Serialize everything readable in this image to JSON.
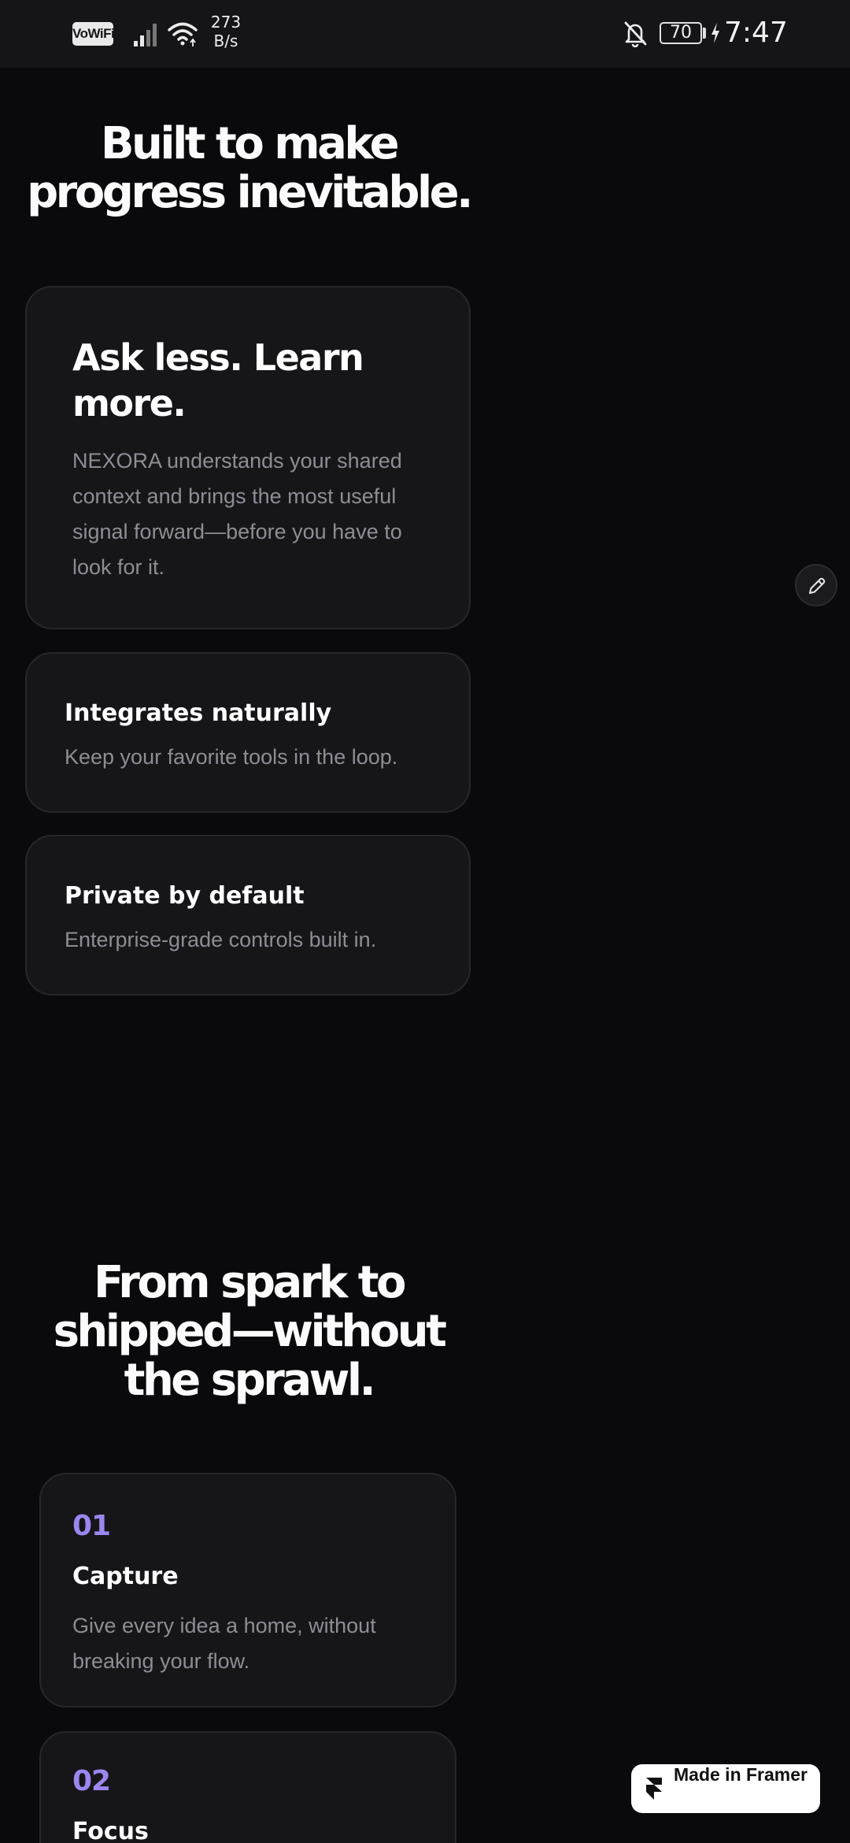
{
  "status_bar": {
    "vowifi": "VoWiFi",
    "net_speed_value": "273",
    "net_speed_unit": "B/s",
    "battery": "70",
    "time": "7:47",
    "icons": [
      "signal-icon",
      "wifi-icon",
      "bell-off-icon",
      "battery-icon",
      "charging-icon"
    ]
  },
  "section1": {
    "heading_line1": "Built to make",
    "heading_line2": "progress inevitable.",
    "feature_card": {
      "title_line1": "Ask less. Learn",
      "title_line2": "more.",
      "text": "NEXORA understands your shared context and brings the most useful signal forward—before you have to look for it."
    },
    "cards": [
      {
        "title": "Integrates naturally",
        "text": "Keep your favorite tools in the loop."
      },
      {
        "title": "Private by default",
        "text": "Enterprise-grade controls built in."
      }
    ]
  },
  "section2": {
    "heading_line1": "From spark to",
    "heading_line2": "shipped—without",
    "heading_line3": "the sprawl.",
    "steps": [
      {
        "num": "01",
        "title": "Capture",
        "text": "Give every idea a home, without breaking your flow."
      },
      {
        "num": "02",
        "title": "Focus",
        "text": ""
      }
    ]
  },
  "badge": {
    "label": "Made in Framer",
    "icon": "framer-logo-icon"
  },
  "edit_button": {
    "icon": "pencil-icon"
  },
  "colors": {
    "background": "#0a0a0d",
    "card": "#161619",
    "card_border": "#26262b",
    "accent": "#9d86f0",
    "muted_text": "#8d8d96"
  }
}
